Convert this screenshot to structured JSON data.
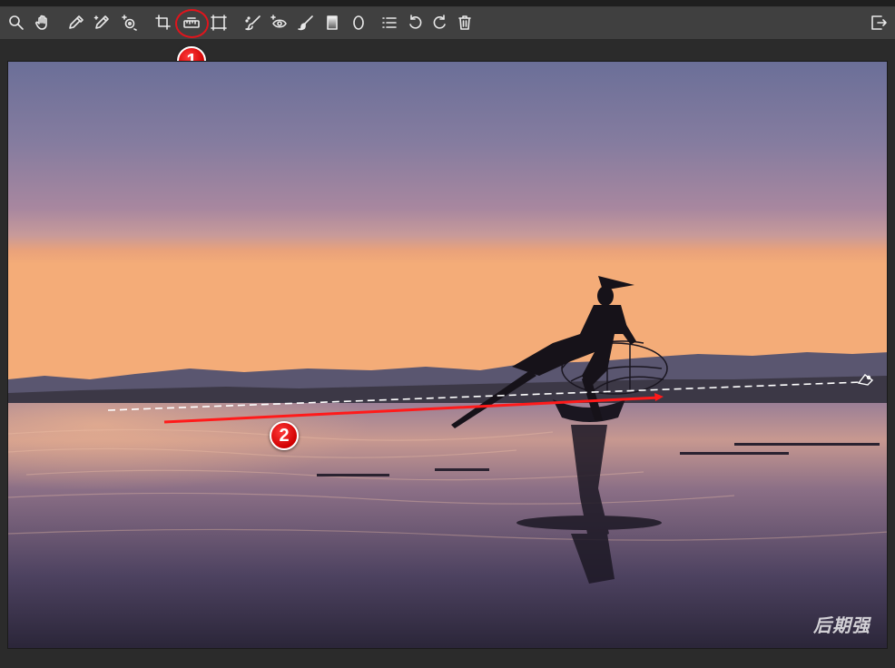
{
  "toolbar": {
    "tools": [
      {
        "name": "zoom-tool",
        "icon": "magnifier-icon"
      },
      {
        "name": "hand-tool",
        "icon": "hand-icon"
      },
      {
        "name": "color-sampler-tool",
        "icon": "eyedropper-icon"
      },
      {
        "name": "target-adjustment-tool",
        "icon": "eyedropper-sparkle-icon"
      },
      {
        "name": "targeted-adjustment-tool",
        "icon": "target-icon"
      },
      {
        "name": "crop-tool",
        "icon": "crop-icon"
      },
      {
        "name": "straighten-tool",
        "icon": "straighten-icon"
      },
      {
        "name": "transform-tool",
        "icon": "transform-icon"
      },
      {
        "name": "spot-removal-tool",
        "icon": "spot-brush-icon"
      },
      {
        "name": "red-eye-tool",
        "icon": "red-eye-icon"
      },
      {
        "name": "adjustment-brush-tool",
        "icon": "brush-icon"
      },
      {
        "name": "graduated-filter-tool",
        "icon": "gradient-icon"
      },
      {
        "name": "radial-filter-tool",
        "icon": "ellipse-icon"
      },
      {
        "name": "preferences-tool",
        "icon": "list-icon"
      },
      {
        "name": "rotate-left-tool",
        "icon": "rotate-ccw-icon"
      },
      {
        "name": "rotate-right-tool",
        "icon": "rotate-cw-icon"
      },
      {
        "name": "trash-tool",
        "icon": "trash-icon"
      },
      {
        "name": "toggle-fullscreen",
        "icon": "fullscreen-exit-icon"
      }
    ],
    "selected": "straighten-tool"
  },
  "annotations": {
    "step1_label": "1",
    "step2_label": "2",
    "highlight_color": "#e0141c"
  },
  "photo": {
    "description_colors": {
      "sky_top": "#6b6f98",
      "sky_mid": "#b08aa6",
      "horizon_glow": "#f0a47a",
      "water": "#3a3448"
    }
  },
  "watermark": "后期强"
}
